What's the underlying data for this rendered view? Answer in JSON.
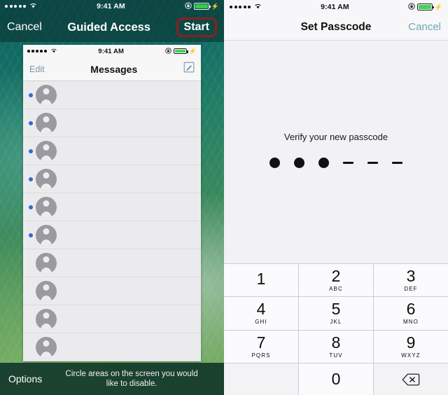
{
  "left_screen": {
    "status_bar": {
      "signal_dots": 5,
      "wifi_icon": "wifi-icon",
      "time": "9:41 AM",
      "lock_icon": "rotation-lock-icon",
      "battery_icon": "battery-icon",
      "charging_icon": "charging-bolt-icon"
    },
    "navbar": {
      "cancel_label": "Cancel",
      "title": "Guided Access",
      "start_label": "Start",
      "highlight_color": "#8e1f1f"
    },
    "inner_phone": {
      "status_bar": {
        "signal_dots": 5,
        "wifi_icon": "wifi-icon",
        "time": "9:41 AM",
        "lock_icon": "rotation-lock-icon",
        "battery_icon": "battery-icon",
        "charging_icon": "charging-bolt-icon"
      },
      "navbar": {
        "edit_label": "Edit",
        "title": "Messages",
        "compose_icon": "compose-icon"
      },
      "rows": [
        {
          "unread": true
        },
        {
          "unread": true
        },
        {
          "unread": true
        },
        {
          "unread": true
        },
        {
          "unread": true
        },
        {
          "unread": true
        },
        {
          "unread": false
        },
        {
          "unread": false
        },
        {
          "unread": false
        },
        {
          "unread": false
        }
      ],
      "unread_dot_color": "#2a6ed4"
    },
    "options_bar": {
      "options_label": "Options",
      "hint_line1": "Circle areas on the screen you would",
      "hint_line2": "like to disable."
    }
  },
  "right_screen": {
    "status_bar": {
      "signal_dots": 5,
      "wifi_icon": "wifi-icon",
      "time": "9:41 AM",
      "lock_icon": "rotation-lock-icon",
      "battery_icon": "battery-icon",
      "charging_icon": "charging-bolt-icon"
    },
    "navbar": {
      "title": "Set Passcode",
      "cancel_label": "Cancel",
      "cancel_color": "#6ea8b8"
    },
    "passcode": {
      "prompt": "Verify your new passcode",
      "total_slots": 6,
      "entered_count": 3,
      "slots": [
        "filled",
        "filled",
        "filled",
        "empty",
        "empty",
        "empty"
      ]
    },
    "keypad": {
      "keys": [
        {
          "digit": "1",
          "letters": ""
        },
        {
          "digit": "2",
          "letters": "ABC"
        },
        {
          "digit": "3",
          "letters": "DEF"
        },
        {
          "digit": "4",
          "letters": "GHI"
        },
        {
          "digit": "5",
          "letters": "JKL"
        },
        {
          "digit": "6",
          "letters": "MNO"
        },
        {
          "digit": "7",
          "letters": "PQRS"
        },
        {
          "digit": "8",
          "letters": "TUV"
        },
        {
          "digit": "9",
          "letters": "WXYZ"
        },
        {
          "digit": "",
          "letters": ""
        },
        {
          "digit": "0",
          "letters": ""
        },
        {
          "digit": "",
          "letters": "",
          "icon": "delete-backspace-icon"
        }
      ]
    }
  }
}
